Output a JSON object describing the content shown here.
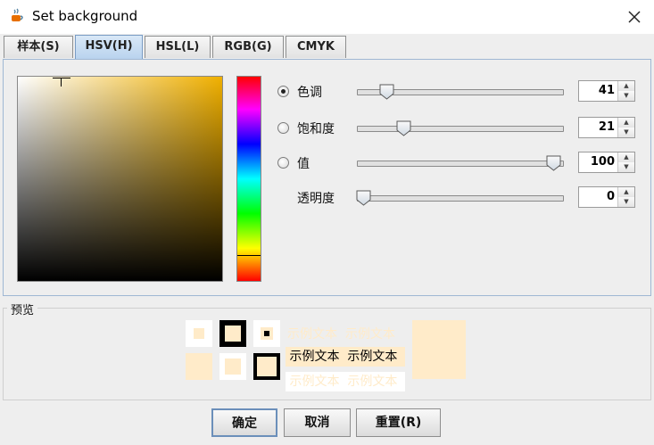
{
  "window": {
    "title": "Set background",
    "icon": "java-cup-icon"
  },
  "tabs": [
    {
      "label": "样本(S)"
    },
    {
      "label": "HSV(H)"
    },
    {
      "label": "HSL(L)"
    },
    {
      "label": "RGB(G)"
    },
    {
      "label": "CMYK"
    }
  ],
  "active_tab": 1,
  "hsv": {
    "rows": [
      {
        "label": "色调",
        "value": "41",
        "fraction": 0.12,
        "radio": true,
        "selected": true
      },
      {
        "label": "饱和度",
        "value": "21",
        "fraction": 0.21,
        "radio": true,
        "selected": false
      },
      {
        "label": "值",
        "value": "100",
        "fraction": 1.0,
        "radio": true,
        "selected": false
      },
      {
        "label": "透明度",
        "value": "0",
        "fraction": 0.0,
        "radio": false,
        "selected": false
      }
    ]
  },
  "preview": {
    "title": "预览",
    "sample_text": "示例文本",
    "color": "#ffebc9"
  },
  "buttons": {
    "ok": "确定",
    "cancel": "取消",
    "reset": "重置(R)"
  }
}
